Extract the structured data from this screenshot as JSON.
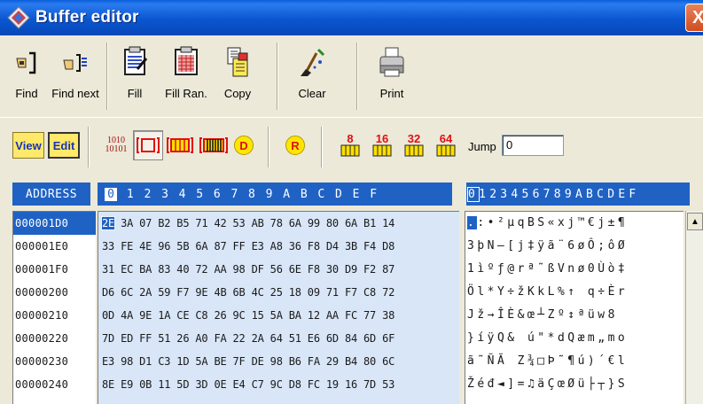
{
  "window": {
    "title": "Buffer editor",
    "close_glyph": "X"
  },
  "toolbar1": {
    "buttons": [
      {
        "label": "Find",
        "icon": "find-icon"
      },
      {
        "label": "Find next",
        "icon": "find-next-icon"
      },
      {
        "label": "Fill",
        "icon": "fill-icon"
      },
      {
        "label": "Fill Ran.",
        "icon": "fill-random-icon"
      },
      {
        "label": "Copy",
        "icon": "copy-icon"
      },
      {
        "label": "Clear",
        "icon": "clear-icon"
      },
      {
        "label": "Print",
        "icon": "print-icon"
      }
    ]
  },
  "toolbar2": {
    "view_label": "View",
    "edit_label": "Edit",
    "binary_label_top": "1010",
    "binary_label_bottom": "10101",
    "decimal_label": "D",
    "reset_label": "R",
    "bits": [
      "8",
      "16",
      "32",
      "64"
    ],
    "jump_label": "Jump",
    "jump_value": "0"
  },
  "grid": {
    "address_header": "ADDRESS",
    "hex_header": [
      "0",
      "1",
      "2",
      "3",
      "4",
      "5",
      "6",
      "7",
      "8",
      "9",
      "A",
      "B",
      "C",
      "D",
      "E",
      "F"
    ],
    "ascii_header": [
      "0",
      "1",
      "2",
      "3",
      "4",
      "5",
      "6",
      "7",
      "8",
      "9",
      "A",
      "B",
      "C",
      "D",
      "E",
      "F"
    ],
    "rows": [
      {
        "address": "000001D0",
        "first": "2E",
        "hex_rest": " 3A 07 B2 B5 71 42 53 AB 78 6A 99 80 6A B1 14",
        "ascii_first": ".",
        "ascii_rest": ":•²µqBS«xj™€j±¶"
      },
      {
        "address": "000001E0",
        "hex": "33 FE 4E 96 5B 6A 87 FF E3 A8 36 F8 D4 3B F4 D8",
        "ascii": "3þN–[j‡ÿã¨6øÔ;ôØ"
      },
      {
        "address": "000001F0",
        "hex": "31 EC BA 83 40 72 AA 98 DF 56 6E F8 30 D9 F2 87",
        "ascii": "1ìºƒ@rª˜ßVnø0Ùò‡"
      },
      {
        "address": "00000200",
        "hex": "D6 6C 2A 59 F7 9E 4B 6B 4C 25 18 09 71 F7 C8 72",
        "ascii": "Öl*Y÷žKkL%↑ q÷Èr"
      },
      {
        "address": "00000210",
        "hex": "0D 4A 9E 1A CE C8 26 9C 15 5A BA 12 AA FC 77 38",
        "ascii": " Jž→ÎÈ&œ┴Zº↕ªüw8"
      },
      {
        "address": "00000220",
        "hex": "7D ED FF 51 26 A0 FA 22 2A 64 51 E6 6D 84 6D 6F",
        "ascii": "}íÿQ& ú\"*dQæm„mo"
      },
      {
        "address": "00000230",
        "hex": "E3 98 D1 C3 1D 5A BE 7F DE 98 B6 FA 29 B4 80 6C",
        "ascii": "ã˜ÑÃ Z¾□Þ˜¶ú)´€l"
      },
      {
        "address": "00000240",
        "hex": "8E E9 0B 11 5D 3D 0E E4 C7 9C D8 FC 19 16 7D 53",
        "ascii": "Žéđ◄]=♫äÇœØü├┬}S"
      }
    ]
  }
}
